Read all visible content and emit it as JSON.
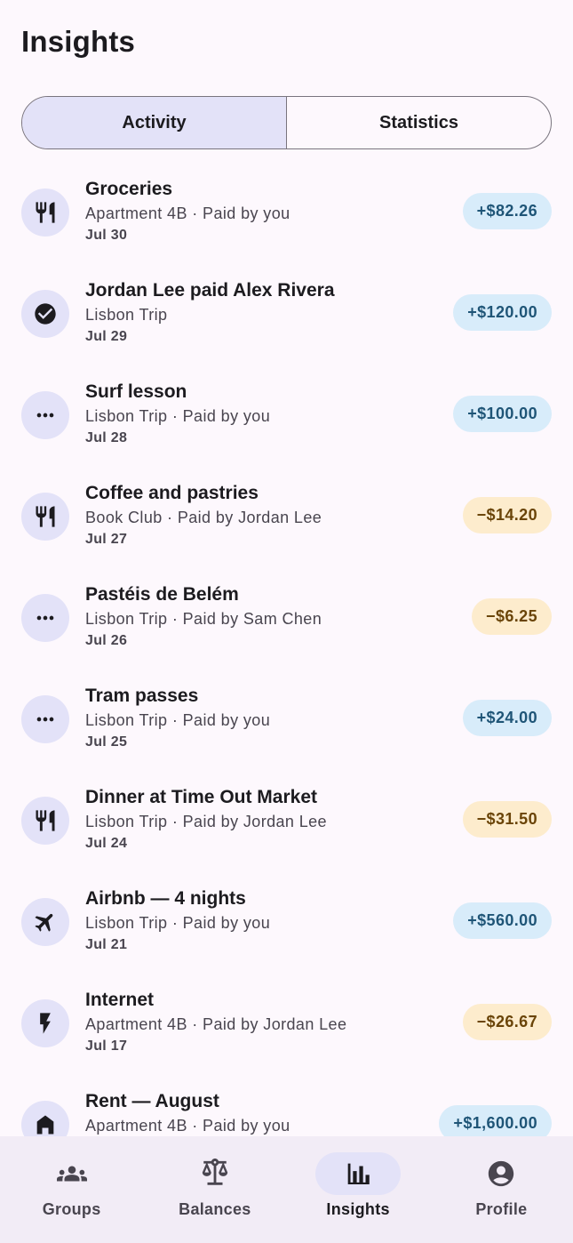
{
  "header": {
    "title": "Insights"
  },
  "tabs": [
    {
      "label": "Activity",
      "selected": true
    },
    {
      "label": "Statistics",
      "selected": false
    }
  ],
  "activity": [
    {
      "icon": "restaurant-icon",
      "title": "Groceries",
      "subtitle": "Apartment 4B · Paid by you",
      "date": "Jul 30",
      "amount": "+$82.26",
      "kind": "pos"
    },
    {
      "icon": "check-circle-icon",
      "title": "Jordan Lee paid Alex Rivera",
      "subtitle": "Lisbon Trip",
      "date": "Jul 29",
      "amount": "+$120.00",
      "kind": "pos"
    },
    {
      "icon": "more-horiz-icon",
      "title": "Surf lesson",
      "subtitle": "Lisbon Trip · Paid by you",
      "date": "Jul 28",
      "amount": "+$100.00",
      "kind": "pos"
    },
    {
      "icon": "restaurant-icon",
      "title": "Coffee and pastries",
      "subtitle": "Book Club · Paid by Jordan Lee",
      "date": "Jul 27",
      "amount": "−$14.20",
      "kind": "neg"
    },
    {
      "icon": "more-horiz-icon",
      "title": "Pastéis de Belém",
      "subtitle": "Lisbon Trip · Paid by Sam Chen",
      "date": "Jul 26",
      "amount": "−$6.25",
      "kind": "neg"
    },
    {
      "icon": "more-horiz-icon",
      "title": "Tram passes",
      "subtitle": "Lisbon Trip · Paid by you",
      "date": "Jul 25",
      "amount": "+$24.00",
      "kind": "pos"
    },
    {
      "icon": "restaurant-icon",
      "title": "Dinner at Time Out Market",
      "subtitle": "Lisbon Trip · Paid by Jordan Lee",
      "date": "Jul 24",
      "amount": "−$31.50",
      "kind": "neg"
    },
    {
      "icon": "flight-icon",
      "title": "Airbnb — 4 nights",
      "subtitle": "Lisbon Trip · Paid by you",
      "date": "Jul 21",
      "amount": "+$560.00",
      "kind": "pos"
    },
    {
      "icon": "bolt-icon",
      "title": "Internet",
      "subtitle": "Apartment 4B · Paid by Jordan Lee",
      "date": "Jul 17",
      "amount": "−$26.67",
      "kind": "neg"
    },
    {
      "icon": "home-icon",
      "title": "Rent — August",
      "subtitle": "Apartment 4B · Paid by you",
      "date": "",
      "amount": "+$1,600.00",
      "kind": "pos"
    }
  ],
  "bottom_nav": [
    {
      "icon": "groups-icon",
      "label": "Groups",
      "active": false
    },
    {
      "icon": "balance-scale-icon",
      "label": "Balances",
      "active": false
    },
    {
      "icon": "bar-chart-icon",
      "label": "Insights",
      "active": true
    },
    {
      "icon": "account-circle-icon",
      "label": "Profile",
      "active": false
    }
  ],
  "colors": {
    "positive_bg": "#d8ecfa",
    "positive_text": "#1f5577",
    "negative_bg": "#fdeccd",
    "negative_text": "#6a4408",
    "accent_container": "#e3e2f8"
  }
}
